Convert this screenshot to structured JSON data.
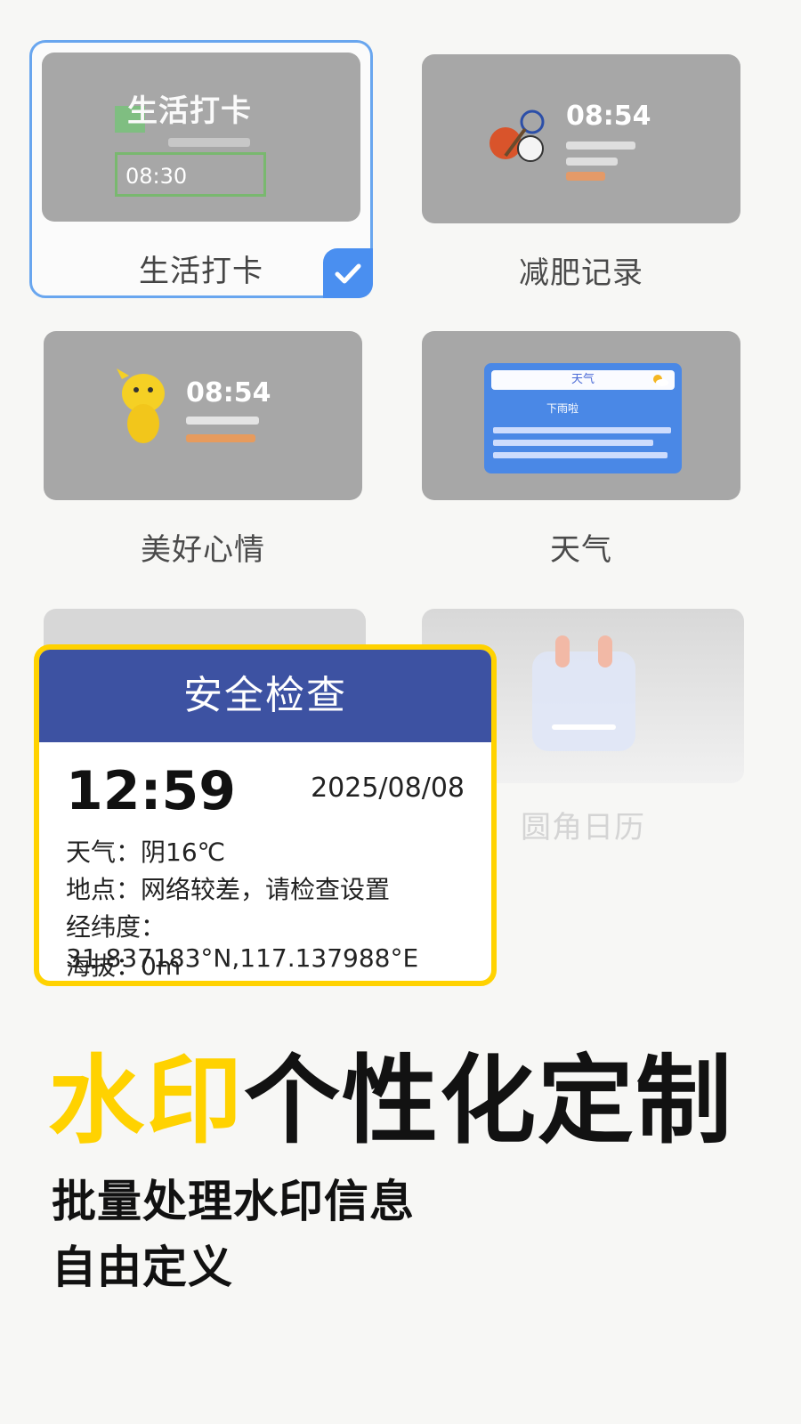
{
  "templates": [
    {
      "label": "生活打卡",
      "selected": true,
      "preview": {
        "title": "生活打卡",
        "time": "08:30"
      }
    },
    {
      "label": "减肥记录",
      "selected": false,
      "preview": {
        "time": "08:54"
      }
    },
    {
      "label": "美好心情",
      "selected": false,
      "preview": {
        "time": "08:54"
      }
    },
    {
      "label": "天气",
      "selected": false,
      "preview": {
        "title": "天气",
        "subtitle": "下雨啦"
      }
    },
    {
      "label": "圆角日历",
      "selected": false
    }
  ],
  "watermark": {
    "title": "安全检查",
    "time": "12:59",
    "date": "2025/08/08",
    "rows": [
      "天气：阴16℃",
      "地点：网络较差，请检查设置",
      "经纬度：31.837183°N,117.137988°E",
      "海拔：0m"
    ]
  },
  "headline": {
    "highlight": "水印",
    "rest": "个性化定制"
  },
  "subtitles": [
    "批量处理水印信息",
    "自由定义"
  ],
  "colors": {
    "accent_yellow": "#ffd200",
    "header_blue": "#3d52a2",
    "select_blue": "#4a8ff0"
  },
  "icons": [
    "check-icon",
    "sports-balls-icon",
    "mascot-icon",
    "calendar-icon",
    "sun-icon"
  ]
}
